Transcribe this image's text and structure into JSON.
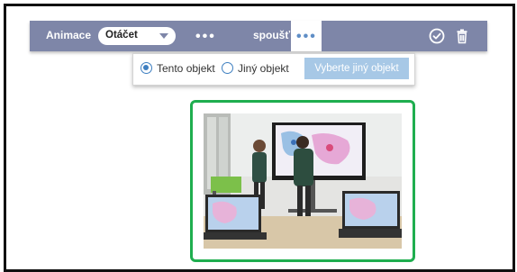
{
  "toolbar": {
    "animation_label": "Animace",
    "animation_select_value": "Otáčet",
    "more_dots": "•••",
    "trigger_label": "spoušť",
    "trigger_dots": "•••"
  },
  "trigger_panel": {
    "options": [
      {
        "label": "Tento objekt",
        "selected": true
      },
      {
        "label": "Jiný objekt",
        "selected": false
      }
    ],
    "choose_button": "Vyberte jiný objekt"
  },
  "colors": {
    "toolbar_bg": "#7e86a8",
    "selection_border": "#1fae4f",
    "radio_accent": "#3e7fc0",
    "choose_button_bg": "#a7c8e6"
  },
  "icons": [
    "chevron-down-icon",
    "check-circle-icon",
    "trash-icon"
  ]
}
